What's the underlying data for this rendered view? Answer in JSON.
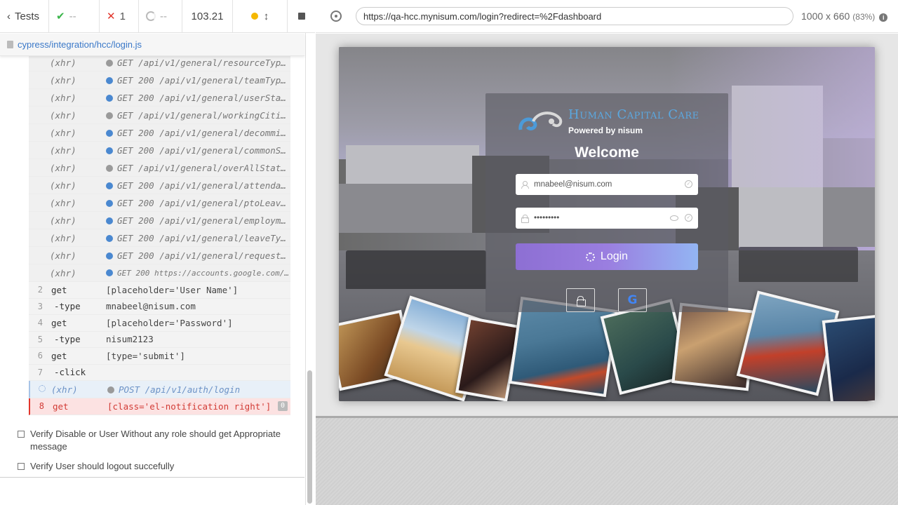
{
  "topbar": {
    "tests_label": "Tests",
    "passed": "--",
    "failed": "1",
    "pending": "--",
    "duration": "103.21"
  },
  "file": {
    "path": "cypress/integration/hcc/login.js"
  },
  "commands": [
    {
      "kind": "xhr",
      "name": "(xhr)",
      "bullet": "gray",
      "msg": "GET /api/v1/general/resourceTyp…"
    },
    {
      "kind": "xhr",
      "name": "(xhr)",
      "bullet": "blue",
      "msg": "GET 200 /api/v1/general/teamTyp…"
    },
    {
      "kind": "xhr",
      "name": "(xhr)",
      "bullet": "blue",
      "msg": "GET 200 /api/v1/general/userSta…"
    },
    {
      "kind": "xhr",
      "name": "(xhr)",
      "bullet": "gray",
      "msg": "GET /api/v1/general/workingCiti…"
    },
    {
      "kind": "xhr",
      "name": "(xhr)",
      "bullet": "blue",
      "msg": "GET 200 /api/v1/general/decommi…"
    },
    {
      "kind": "xhr",
      "name": "(xhr)",
      "bullet": "blue",
      "msg": "GET 200 /api/v1/general/commonS…"
    },
    {
      "kind": "xhr",
      "name": "(xhr)",
      "bullet": "gray",
      "msg": "GET /api/v1/general/overAllStat…"
    },
    {
      "kind": "xhr",
      "name": "(xhr)",
      "bullet": "blue",
      "msg": "GET 200 /api/v1/general/attenda…"
    },
    {
      "kind": "xhr",
      "name": "(xhr)",
      "bullet": "blue",
      "msg": "GET 200 /api/v1/general/ptoLeav…"
    },
    {
      "kind": "xhr",
      "name": "(xhr)",
      "bullet": "blue",
      "msg": "GET 200 /api/v1/general/employm…"
    },
    {
      "kind": "xhr",
      "name": "(xhr)",
      "bullet": "blue",
      "msg": "GET 200 /api/v1/general/leaveTy…"
    },
    {
      "kind": "xhr",
      "name": "(xhr)",
      "bullet": "blue",
      "msg": "GET 200 /api/v1/general/request…"
    },
    {
      "kind": "xhr-small",
      "name": "(xhr)",
      "bullet": "blue",
      "msg": "GET 200 https://accounts.google.com/o/…"
    },
    {
      "kind": "step",
      "num": "2",
      "name": "get",
      "msg": "[placeholder='User Name']"
    },
    {
      "kind": "step-child",
      "num": "3",
      "name": "-type",
      "msg": "mnabeel@nisum.com"
    },
    {
      "kind": "step",
      "num": "4",
      "name": "get",
      "msg": "[placeholder='Password']"
    },
    {
      "kind": "step-child",
      "num": "5",
      "name": "-type",
      "msg": "nisum2123"
    },
    {
      "kind": "step",
      "num": "6",
      "name": "get",
      "msg": "[type='submit']"
    },
    {
      "kind": "step-child",
      "num": "7",
      "name": "-click",
      "msg": ""
    },
    {
      "kind": "pending",
      "name": "(xhr)",
      "bullet": "gray",
      "msg": "POST /api/v1/auth/login"
    },
    {
      "kind": "failed",
      "num": "8",
      "name": "get",
      "msg": "[class='el-notification right']",
      "badge": "0"
    }
  ],
  "tests": [
    {
      "label": "Verify Disable or User Without any role should get Appropriate message"
    },
    {
      "label": "Verify User should logout succefully"
    }
  ],
  "aut": {
    "url": "https://qa-hcc.mynisum.com/login?redirect=%2Fdashboard",
    "viewport": "1000 x 660",
    "zoom": "(83%)"
  },
  "app": {
    "brand_title": "Human Capital Care",
    "brand_sub": "Powered by nisum",
    "welcome": "Welcome",
    "username_value": "mnabeel@nisum.com",
    "password_mask": "•••••••••",
    "login_label": "Login",
    "google_glyph": "G"
  },
  "colors": {
    "pass": "#3ab54a",
    "fail": "#e2362c",
    "link": "#3a78c8",
    "login_gradient_start": "#8d6fd3",
    "login_gradient_end": "#93b5f3"
  }
}
